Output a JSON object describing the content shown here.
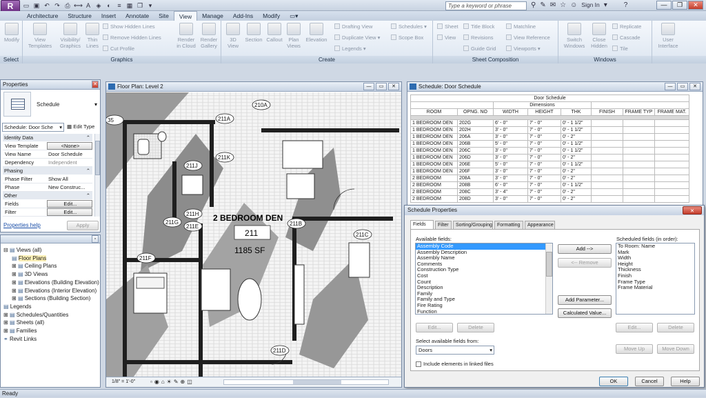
{
  "app": {
    "logo": "R",
    "search_placeholder": "Type a keyword or phrase",
    "sign_in": "Sign In"
  },
  "ribbon_tabs": [
    "Architecture",
    "Structure",
    "Insert",
    "Annotate",
    "Site",
    "View",
    "Manage",
    "Add-Ins",
    "Modify"
  ],
  "active_tab": "View",
  "ribbon": {
    "select_label": "Select",
    "modify": "Modify",
    "graphics_label": "Graphics",
    "view_templates": "View\nTemplates",
    "visibility_graphics": "Visibility/\nGraphics",
    "thin_lines": "Thin\nLines",
    "show_hidden": "Show Hidden Lines",
    "remove_hidden": "Remove Hidden Lines",
    "cut_profile": "Cut Profile",
    "render_cloud": "Render\nin Cloud",
    "render_gallery": "Render\nGallery",
    "create_label": "Create",
    "view_3d": "3D\nView",
    "section": "Section",
    "callout": "Callout",
    "plan_views": "Plan\nViews",
    "elevation": "Elevation",
    "drafting_view": "Drafting View",
    "duplicate_view": "Duplicate View",
    "legends": "Legends",
    "schedules": "Schedules",
    "scope_box": "Scope Box",
    "sheet_label": "Sheet Composition",
    "sheet": "Sheet",
    "view": "View",
    "title_block": "Title Block",
    "revisions": "Revisions",
    "guide_grid": "Guide Grid",
    "matchline": "Matchline",
    "view_reference": "View Reference",
    "viewports": "Viewports",
    "windows_label": "Windows",
    "switch_windows": "Switch\nWindows",
    "close_hidden": "Close\nHidden",
    "replicate": "Replicate",
    "cascade": "Cascade",
    "tile": "Tile",
    "user_interface": "User\nInterface"
  },
  "properties": {
    "title": "Properties",
    "type_name": "Schedule",
    "selector": "Schedule: Door Sche",
    "edit_type": "Edit Type",
    "groups": [
      {
        "name": "Identity Data",
        "rows": [
          [
            "View Template",
            "<None>"
          ],
          [
            "View Name",
            "Door Schedule"
          ],
          [
            "Dependency",
            "Independent"
          ]
        ]
      },
      {
        "name": "Phasing",
        "rows": [
          [
            "Phase Filter",
            "Show All"
          ],
          [
            "Phase",
            "New Construc..."
          ]
        ]
      },
      {
        "name": "Other",
        "rows": [
          [
            "Fields",
            "Edit..."
          ],
          [
            "Filter",
            "Edit..."
          ]
        ]
      }
    ],
    "help": "Properties help",
    "apply": "Apply"
  },
  "browser": {
    "items": [
      "Views (all)",
      "Floor Plans",
      "Ceiling Plans",
      "3D Views",
      "Elevations (Building Elevation)",
      "Elevations (Interior Elevation)",
      "Sections (Building Section)",
      "Legends",
      "Schedules/Quantities",
      "Sheets (all)",
      "Families",
      "Revit Links"
    ]
  },
  "floorplan": {
    "title": "Floor Plan: Level 2",
    "room_name": "2 BEDROOM DEN",
    "room_number": "211",
    "room_area": "1185 SF",
    "scale": "1/8\" = 1'-0\"",
    "tags": [
      "210A",
      "211A",
      "211K",
      "211J",
      "211H",
      "211G",
      "211E",
      "211F",
      "211B",
      "211C",
      "211D",
      "35"
    ]
  },
  "schedule": {
    "title": "Schedule: Door Schedule",
    "heading": "Door Schedule",
    "dimensions": "Dimensions",
    "columns": [
      "ROOM",
      "OPNG. NO",
      "WIDTH",
      "HEIGHT",
      "THK",
      "FINISH",
      "FRAME TYP",
      "FRAME MAT."
    ],
    "rows": [
      [
        "1 BEDROOM DEN",
        "202G",
        "6' - 0\"",
        "7' - 0\"",
        "0' - 1 1/2\""
      ],
      [
        "1 BEDROOM DEN",
        "202H",
        "3' - 0\"",
        "7' - 0\"",
        "0' - 1 1/2\""
      ],
      [
        "1 BEDROOM DEN",
        "206A",
        "3' - 0\"",
        "7' - 0\"",
        "0' - 2\""
      ],
      [
        "1 BEDROOM DEN",
        "206B",
        "5' - 0\"",
        "7' - 0\"",
        "0' - 1 1/2\""
      ],
      [
        "1 BEDROOM DEN",
        "206C",
        "3' - 0\"",
        "7' - 0\"",
        "0' - 1 1/2\""
      ],
      [
        "1 BEDROOM DEN",
        "206D",
        "3' - 0\"",
        "7' - 0\"",
        "0' - 2\""
      ],
      [
        "1 BEDROOM DEN",
        "206E",
        "5' - 0\"",
        "7' - 0\"",
        "0' - 1 1/2\""
      ],
      [
        "1 BEDROOM DEN",
        "206F",
        "3' - 0\"",
        "7' - 0\"",
        "0' - 2\""
      ],
      [
        "2 BEDROOM",
        "208A",
        "3' - 0\"",
        "7' - 0\"",
        "0' - 2\""
      ],
      [
        "2 BEDROOM",
        "208B",
        "6' - 0\"",
        "7' - 0\"",
        "0' - 1 1/2\""
      ],
      [
        "2 BEDROOM",
        "208C",
        "3' - 4\"",
        "7' - 0\"",
        "0' - 2\""
      ],
      [
        "2 BEDROOM",
        "208D",
        "3' - 0\"",
        "7' - 0\"",
        "0' - 2\""
      ]
    ]
  },
  "dialog": {
    "title": "Schedule Properties",
    "tabs": [
      "Fields",
      "Filter",
      "Sorting/Grouping",
      "Formatting",
      "Appearance"
    ],
    "available_label": "Available fields:",
    "available": [
      "Assembly Code",
      "Assembly Description",
      "Assembly Name",
      "Comments",
      "Construction Type",
      "Cost",
      "Count",
      "Description",
      "Family",
      "Family and Type",
      "Fire Rating",
      "Function",
      "Head Height"
    ],
    "scheduled_label": "Scheduled fields (in order):",
    "scheduled": [
      "To Room: Name",
      "Mark",
      "Width",
      "Height",
      "Thickness",
      "Finish",
      "Frame Type",
      "Frame Material"
    ],
    "add": "Add -->",
    "remove": "<-- Remove",
    "add_parameter": "Add Parameter...",
    "calculated_value": "Calculated Value...",
    "edit": "Edit...",
    "delete": "Delete",
    "edit2": "Edit...",
    "delete2": "Delete",
    "select_from_label": "Select available fields from:",
    "select_from": "Doors",
    "include_linked": "Include elements in linked files",
    "move_up": "Move Up",
    "move_down": "Move Down",
    "ok": "OK",
    "cancel": "Cancel",
    "help": "Help"
  },
  "status": "Ready"
}
